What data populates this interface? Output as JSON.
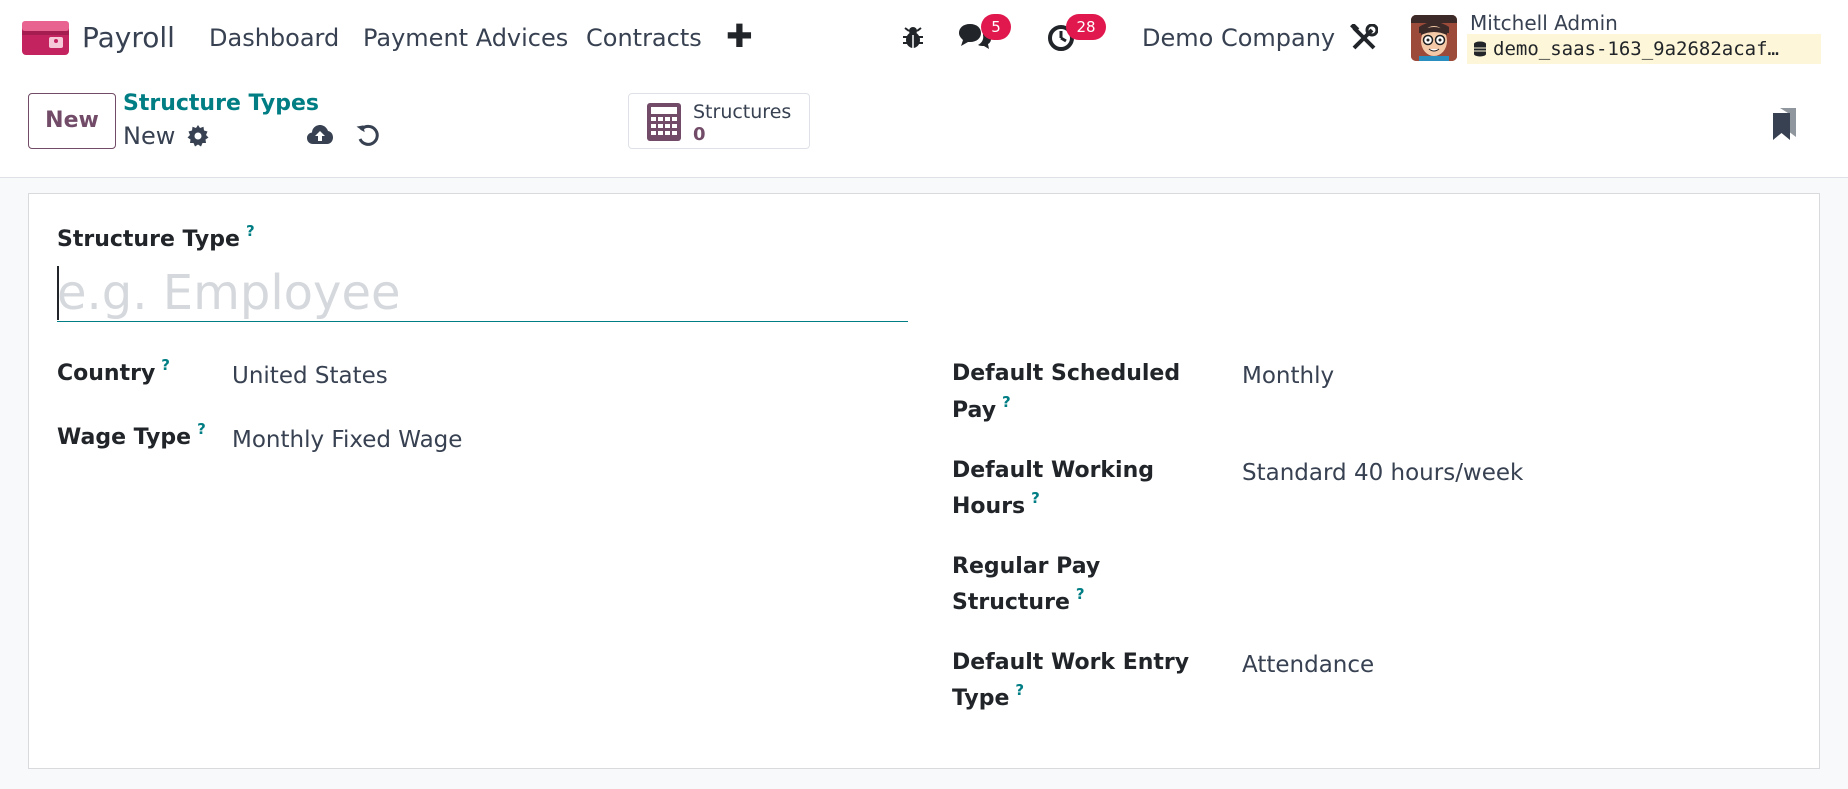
{
  "navbar": {
    "app_name": "Payroll",
    "menu": [
      "Dashboard",
      "Payment Advices",
      "Contracts"
    ],
    "plus": "✚",
    "messages_count": "5",
    "activities_count": "28",
    "company": "Demo Company",
    "user_name": "Mitchell Admin",
    "database": "demo_saas-163_9a2682acaf…"
  },
  "control_panel": {
    "new_button": "New",
    "breadcrumb_parent": "Structure Types",
    "breadcrumb_current": "New",
    "smart_button": {
      "label": "Structures",
      "value": "0"
    }
  },
  "form": {
    "structure_type_label": "Structure Type",
    "help_mark": "?",
    "structure_type_placeholder": "e.g. Employee",
    "country_label": "Country",
    "country_value": "United States",
    "wage_type_label": "Wage Type",
    "wage_type_value": "Monthly Fixed Wage",
    "default_scheduled_pay_label_1": "Default Scheduled",
    "default_scheduled_pay_label_2": "Pay",
    "default_scheduled_pay_value": "Monthly",
    "default_working_hours_label_1": "Default Working",
    "default_working_hours_label_2": "Hours",
    "default_working_hours_value": "Standard 40 hours/week",
    "regular_pay_structure_label_1": "Regular Pay",
    "regular_pay_structure_label_2": "Structure",
    "regular_pay_structure_value": "",
    "default_work_entry_type_label_1": "Default Work Entry",
    "default_work_entry_type_label_2": "Type",
    "default_work_entry_type_value": "Attendance"
  },
  "colors": {
    "brand": "#714b67",
    "accent_teal": "#017e84",
    "badge": "#e0184d"
  }
}
